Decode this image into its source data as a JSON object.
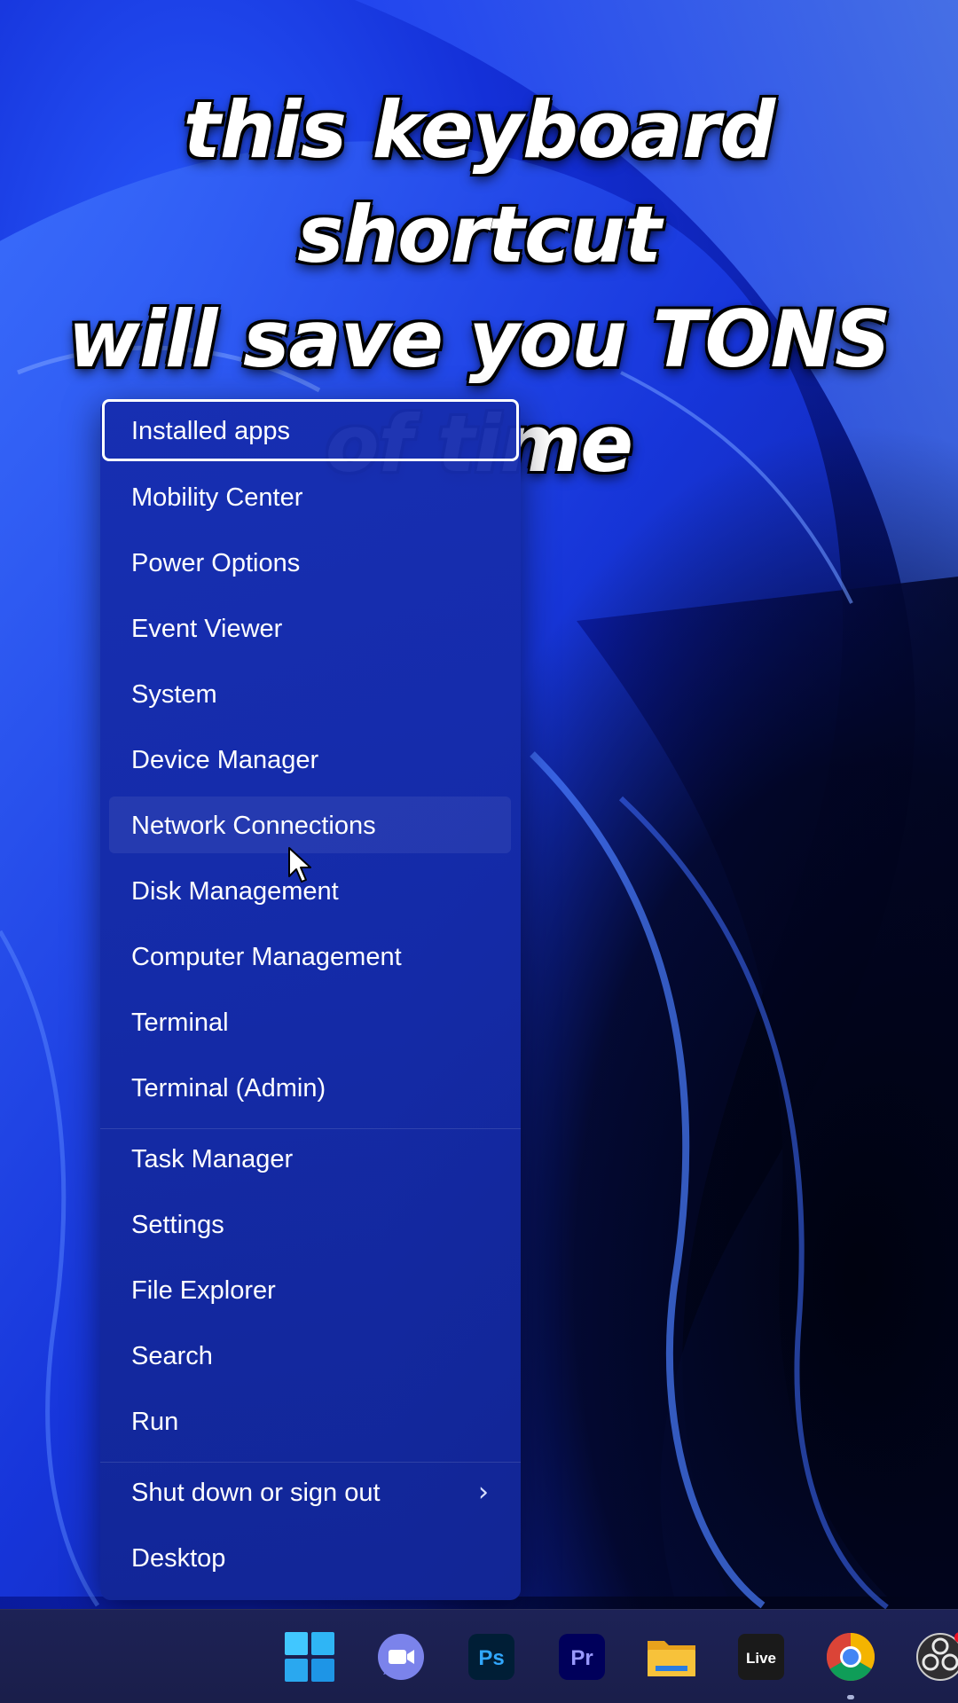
{
  "caption": {
    "line1": "this keyboard shortcut",
    "line2": "will save you TONS",
    "line3": "of time"
  },
  "menu": {
    "items": [
      {
        "label": "Installed apps"
      },
      {
        "label": "Mobility Center"
      },
      {
        "label": "Power Options"
      },
      {
        "label": "Event Viewer"
      },
      {
        "label": "System"
      },
      {
        "label": "Device Manager"
      },
      {
        "label": "Network Connections"
      },
      {
        "label": "Disk Management"
      },
      {
        "label": "Computer Management"
      },
      {
        "label": "Terminal"
      },
      {
        "label": "Terminal (Admin)"
      },
      {
        "label": "Task Manager"
      },
      {
        "label": "Settings"
      },
      {
        "label": "File Explorer"
      },
      {
        "label": "Search"
      },
      {
        "label": "Run"
      },
      {
        "label": "Shut down or sign out"
      },
      {
        "label": "Desktop"
      }
    ],
    "submenu_chevron": "›"
  },
  "taskbar": {
    "apps": [
      {
        "name": "start-icon"
      },
      {
        "name": "camera-chat-icon"
      },
      {
        "name": "photoshop-icon",
        "text": "Ps"
      },
      {
        "name": "premiere-icon",
        "text": "Pr"
      },
      {
        "name": "folder-icon"
      },
      {
        "name": "ableton-live-icon",
        "text": "Live"
      },
      {
        "name": "chrome-icon"
      },
      {
        "name": "obs-icon"
      }
    ]
  },
  "colors": {
    "menu_bg": "#1a2ea8",
    "accent_win": "#2ec4ff",
    "photoshop": "#31a8ff",
    "premiere": "#9999ff",
    "folder": "#f7c23a"
  }
}
